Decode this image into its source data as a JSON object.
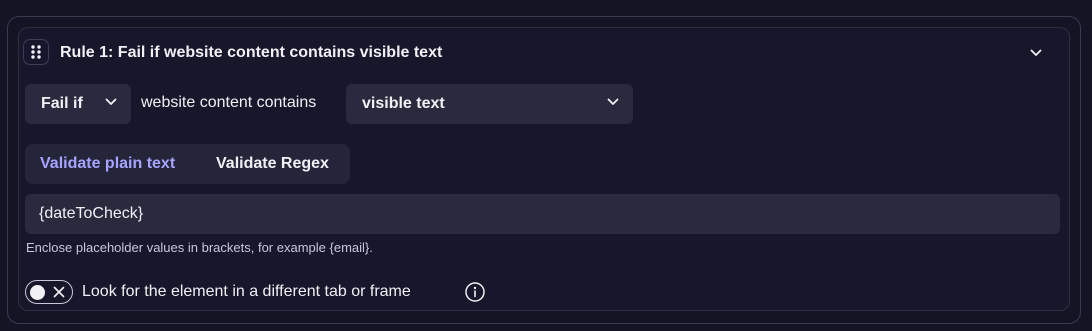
{
  "rule": {
    "title": "Rule 1: Fail if website content contains visible text"
  },
  "condition": {
    "mode_select": {
      "value": "Fail if"
    },
    "static_text": "website content contains",
    "target_select": {
      "value": "visible text"
    }
  },
  "validation_tabs": [
    {
      "label": "Validate plain text",
      "active": true
    },
    {
      "label": "Validate Regex",
      "active": false
    }
  ],
  "text_input": {
    "value": "{dateToCheck}"
  },
  "hint": "Enclose placeholder values in brackets, for example {email}.",
  "toggle": {
    "label": "Look for the element in a different tab or frame",
    "checked": false
  },
  "colors": {
    "background": "#151424",
    "control_bg": "#2a2a3e",
    "active_tab": "#a7a4ff"
  },
  "icons": [
    "drag-handle-icon",
    "chevron-down-icon",
    "x-icon",
    "info-icon"
  ]
}
